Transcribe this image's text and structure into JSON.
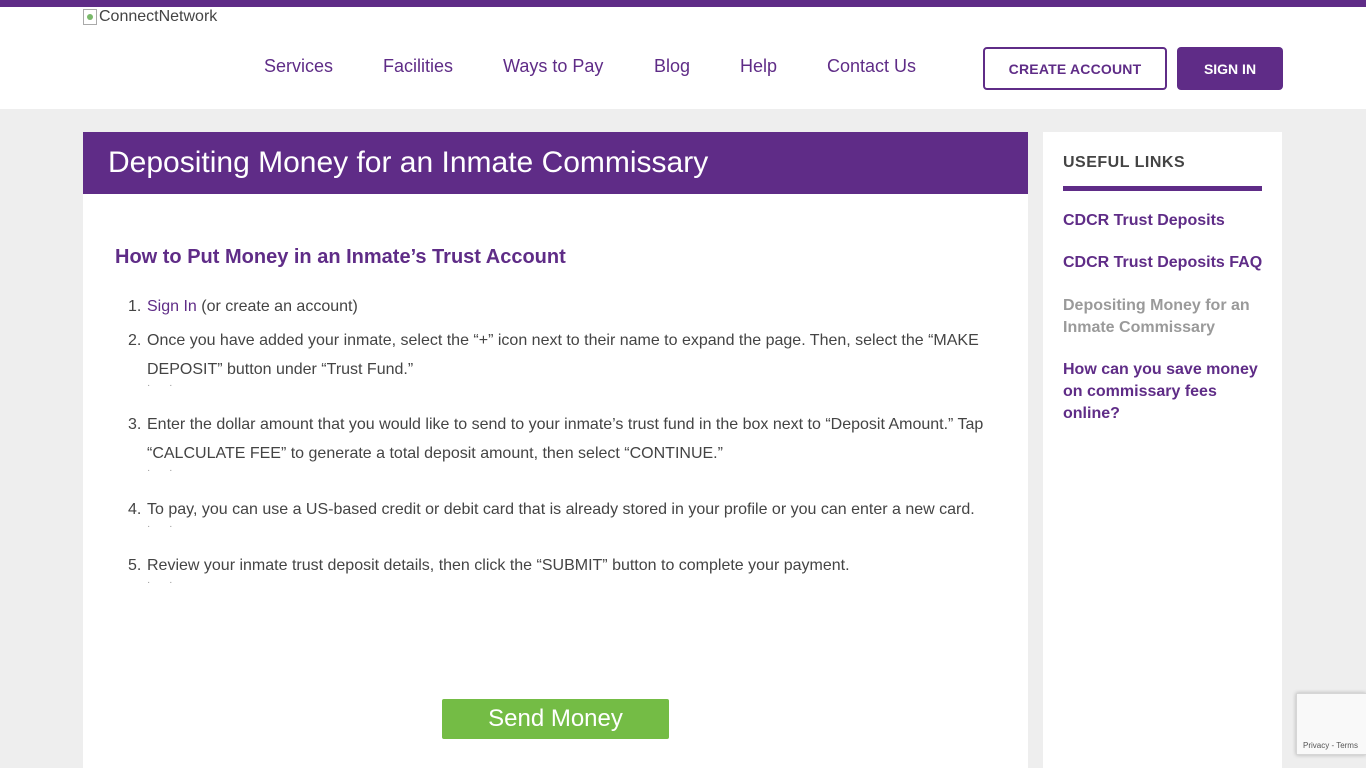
{
  "header": {
    "logo_alt": "ConnectNetwork",
    "nav": [
      {
        "label": "Services"
      },
      {
        "label": "Facilities"
      },
      {
        "label": "Ways to Pay"
      },
      {
        "label": "Blog"
      },
      {
        "label": "Help"
      },
      {
        "label": "Contact Us"
      }
    ],
    "create_account_label": "CREATE ACCOUNT",
    "sign_in_label": "SIGN IN"
  },
  "main": {
    "title": "Depositing Money for an Inmate Commissary",
    "subheading": "How to Put Money in an Inmate’s Trust Account",
    "steps": [
      {
        "number": "1.",
        "link": "Sign In",
        "text": " (or create an account)"
      },
      {
        "number": "2.",
        "text": "Once you have added your inmate, select the “+” icon next to their name to expand the page. Then, select the “MAKE DEPOSIT” button under “Trust Fund.”"
      },
      {
        "number": "3.",
        "text": "Enter the dollar amount that you would like to send to your inmate’s trust fund in the box next to “Deposit Amount.” Tap “CALCULATE FEE” to generate a total deposit amount, then select “CONTINUE.”"
      },
      {
        "number": "4.",
        "text": "To pay, you can use a US-based credit or debit card that is already stored in your profile or you can enter a new card."
      },
      {
        "number": "5.",
        "text": "Review your inmate trust deposit details, then click the “SUBMIT” button to complete your payment."
      }
    ],
    "send_money_label": "Send Money"
  },
  "sidebar": {
    "title": "USEFUL LINKS",
    "links": [
      {
        "label": "CDCR Trust Deposits"
      },
      {
        "label": "CDCR Trust Deposits FAQ"
      },
      {
        "label": "Depositing Money for an Inmate Commissary"
      },
      {
        "label": "How can you save money on commissary fees online?"
      }
    ]
  },
  "recaptcha": {
    "text": "Privacy - Terms"
  },
  "colors": {
    "brand": "#5f2c87",
    "send_button": "#74bc45",
    "background": "#eeeeee"
  }
}
